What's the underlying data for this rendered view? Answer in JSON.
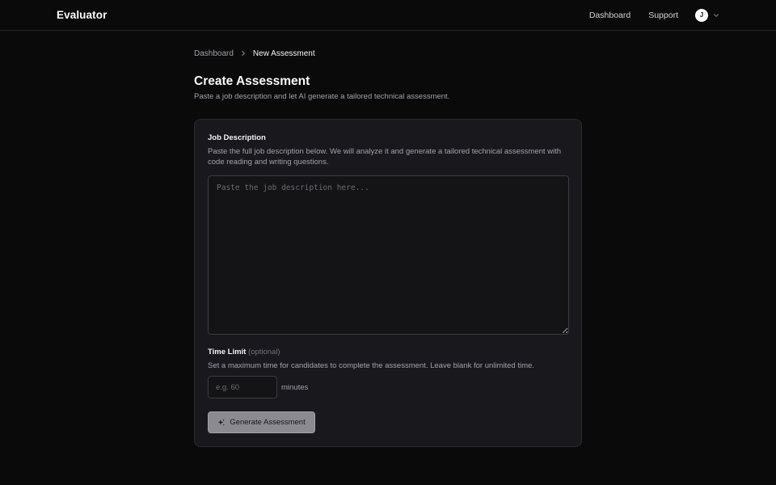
{
  "header": {
    "brand": "Evaluator",
    "nav": {
      "dashboard": "Dashboard",
      "support": "Support"
    },
    "user": {
      "initial": "J"
    }
  },
  "breadcrumb": {
    "parent": "Dashboard",
    "current": "New Assessment"
  },
  "page": {
    "title": "Create Assessment",
    "subtitle": "Paste a job description and let AI generate a tailored technical assessment."
  },
  "form": {
    "job_description": {
      "label": "Job Description",
      "help": "Paste the full job description below. We will analyze it and generate a tailored technical assessment with code reading and writing questions.",
      "placeholder": "Paste the job description here...",
      "value": ""
    },
    "time_limit": {
      "label": "Time Limit",
      "optional": "(optional)",
      "help": "Set a maximum time for candidates to complete the assessment. Leave blank for unlimited time.",
      "placeholder": "e.g. 60",
      "value": "",
      "unit": "minutes"
    },
    "submit_label": "Generate Assessment"
  },
  "icons": {
    "chevron": "chevron-down-icon",
    "separator": "chevron-right-icon",
    "sparkle": "sparkles-icon"
  },
  "colors": {
    "background": "#0a0a0b",
    "card": "#19191d",
    "button": "#8a8a90"
  }
}
